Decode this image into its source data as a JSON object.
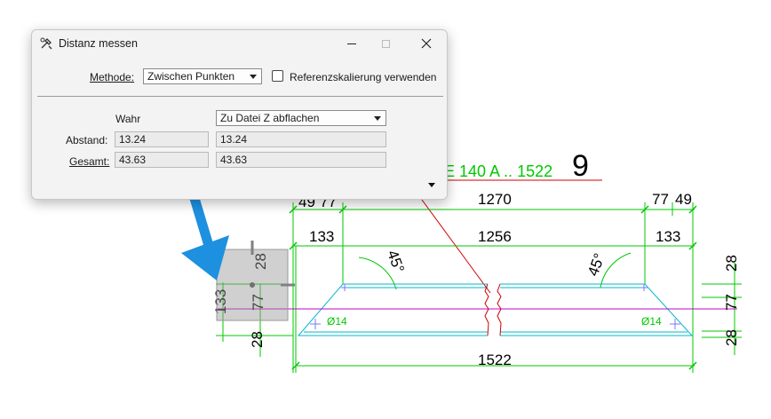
{
  "dialog": {
    "title": "Distanz messen",
    "icon": "measure-tool-icon",
    "method_label": "Methode:",
    "method_value": "Zwischen Punkten",
    "reference_scaling_label": "Referenzskalierung verwenden",
    "reference_scaling_checked": false,
    "column_true_header": "Wahr",
    "flatten_option": "Zu Datei Z abflachen",
    "distance_label": "Abstand:",
    "distance_true": "13.24",
    "distance_flat": "13.24",
    "total_label": "Gesamt:",
    "total_true": "43.63",
    "total_flat": "43.63"
  },
  "drawing": {
    "title_fragment": "E 140 A .. 1522",
    "sheet_number": "9",
    "dims": {
      "top_left_a": "49",
      "top_left_b": "77",
      "top_total": "1270",
      "top_right_a": "77",
      "top_right_b": "49",
      "mid_left": "133",
      "mid_center": "1256",
      "mid_right": "133",
      "bottom_total": "1522",
      "angle_left": "45°",
      "angle_right": "45°",
      "left_133": "133",
      "left_28_top": "28",
      "left_77": "77",
      "left_28_bottom": "28",
      "right_28_top": "28",
      "right_77": "77",
      "right_28_bottom": "28",
      "dia_left": "Ø14",
      "dia_right": "Ø14"
    }
  },
  "colors": {
    "dimension": "#00c800",
    "rebar_cyan": "#00b8c8",
    "axis_magenta": "#c800c8",
    "section_red": "#d00000",
    "arrow_blue": "#1e90e0"
  }
}
